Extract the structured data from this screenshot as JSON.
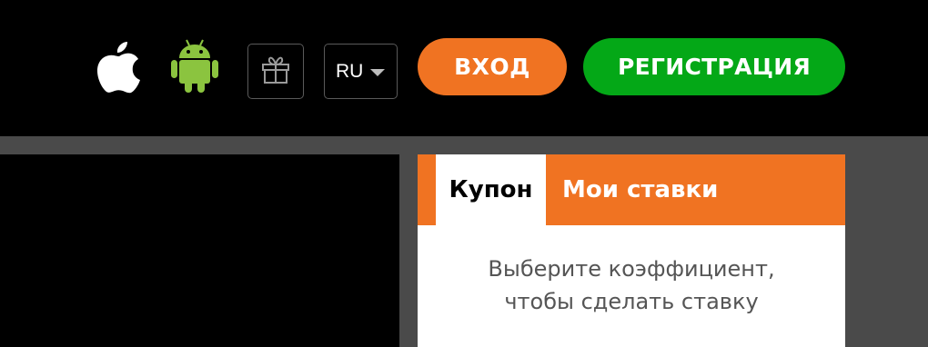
{
  "header": {
    "apple_icon": "apple-icon",
    "android_icon": "android-icon",
    "gift_icon": "gift-icon",
    "language": {
      "selected": "RU"
    },
    "login_label": "ВХОД",
    "register_label": "РЕГИСТРАЦИЯ"
  },
  "coupon": {
    "tabs": [
      {
        "label": "Купон",
        "active": true
      },
      {
        "label": "Мои ставки",
        "active": false
      }
    ],
    "empty_message": {
      "line1": "Выберите коэффициент,",
      "line2": "чтобы сделать ставку"
    }
  },
  "colors": {
    "accent_orange": "#f07322",
    "register_green": "#04a817",
    "android_green": "#8bc43f",
    "background": "#000000",
    "content_bg": "#4a4a4a"
  }
}
